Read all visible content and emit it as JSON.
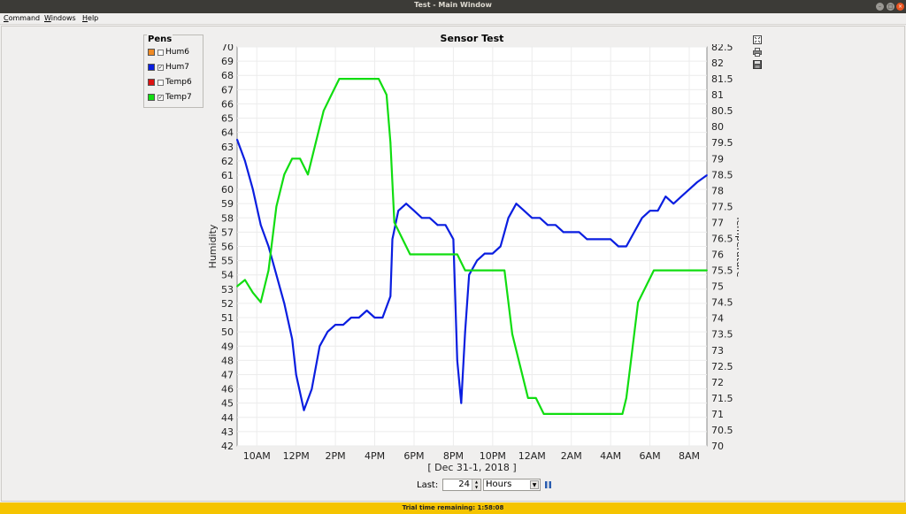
{
  "window": {
    "title": "Test - Main Window",
    "min_glyph": "–",
    "max_glyph": "□",
    "close_glyph": "×"
  },
  "menu": [
    {
      "mnemonic": "C",
      "rest": "ommand"
    },
    {
      "mnemonic": "W",
      "rest": "indows"
    },
    {
      "mnemonic": "H",
      "rest": "elp"
    }
  ],
  "pens": {
    "title": "Pens",
    "items": [
      {
        "label": "Hum6",
        "color": "#f08a24",
        "checked": false,
        "mark": ""
      },
      {
        "label": "Hum7",
        "color": "#0a1ee0",
        "checked": true,
        "mark": "✓"
      },
      {
        "label": "Temp6",
        "color": "#dd1111",
        "checked": false,
        "mark": ""
      },
      {
        "label": "Temp7",
        "color": "#11dd11",
        "checked": true,
        "mark": "✓"
      }
    ]
  },
  "toolbar_icons": [
    "zoom-icon",
    "print-icon",
    "save-icon"
  ],
  "controls": {
    "last_label": "Last:",
    "last_value": "24",
    "unit": "Hours",
    "spin_up": "▲",
    "spin_down": "▼",
    "dropdown_glyph": "▼"
  },
  "status": {
    "text": "Trial time remaining: 1:58:08"
  },
  "chart_data": {
    "type": "line",
    "title": "Sensor Test",
    "xlabel": "[ Dec 31-1, 2018 ]",
    "ylabel": "Humidity",
    "y2label": "Temperature",
    "x_ticks": [
      "10AM",
      "12PM",
      "2PM",
      "4PM",
      "6PM",
      "8PM",
      "10PM",
      "12AM",
      "2AM",
      "4AM",
      "6AM",
      "8AM"
    ],
    "x_range_hours": [
      9.0,
      32.9
    ],
    "ylim": [
      42,
      70
    ],
    "y_ticks": [
      42,
      43,
      44,
      45,
      46,
      47,
      48,
      49,
      50,
      51,
      52,
      53,
      54,
      55,
      56,
      57,
      58,
      59,
      60,
      61,
      62,
      63,
      64,
      65,
      66,
      67,
      68,
      69,
      70
    ],
    "y2lim": [
      70,
      82.5
    ],
    "y2_ticks": [
      "70",
      "70.5",
      "71",
      "71.5",
      "72",
      "72.5",
      "73",
      "73.5",
      "74",
      "74.5",
      "75",
      "75.5",
      "76",
      "76.5",
      "77",
      "77.5",
      "78",
      "78.5",
      "79",
      "79.5",
      "80",
      "80.5",
      "81",
      "81.5",
      "82",
      "82.5"
    ],
    "grid": true,
    "series": [
      {
        "name": "Hum7",
        "axis": "left",
        "color": "#0a1ee0",
        "x": [
          9.0,
          9.4,
          9.8,
          10.2,
          10.6,
          11.0,
          11.4,
          11.8,
          12.0,
          12.4,
          12.8,
          13.2,
          13.6,
          14.0,
          14.4,
          14.8,
          15.2,
          15.6,
          16.0,
          16.4,
          16.8,
          16.9,
          17.2,
          17.6,
          18.0,
          18.4,
          18.8,
          19.2,
          19.6,
          20.0,
          20.2,
          20.4,
          20.6,
          20.8,
          21.2,
          21.6,
          22.0,
          22.4,
          22.6,
          22.8,
          23.2,
          23.6,
          24.0,
          24.4,
          24.8,
          25.2,
          25.6,
          26.0,
          26.4,
          26.8,
          27.2,
          27.6,
          28.0,
          28.4,
          28.8,
          29.2,
          29.6,
          30.0,
          30.4,
          30.8,
          31.2,
          31.6,
          32.0,
          32.4,
          32.9
        ],
        "values": [
          63.5,
          62.0,
          60.0,
          57.5,
          56.0,
          54.0,
          52.0,
          49.5,
          47.0,
          44.5,
          46.0,
          49.0,
          50.0,
          50.5,
          50.5,
          51.0,
          51.0,
          51.5,
          51.0,
          51.0,
          52.5,
          56.5,
          58.5,
          59.0,
          58.5,
          58.0,
          58.0,
          57.5,
          57.5,
          56.5,
          48.0,
          45.0,
          50.0,
          54.0,
          55.0,
          55.5,
          55.5,
          56.0,
          57.0,
          58.0,
          59.0,
          58.5,
          58.0,
          58.0,
          57.5,
          57.5,
          57.0,
          57.0,
          57.0,
          56.5,
          56.5,
          56.5,
          56.5,
          56.0,
          56.0,
          57.0,
          58.0,
          58.5,
          58.5,
          59.5,
          59.0,
          59.5,
          60.0,
          60.5,
          61.0
        ]
      },
      {
        "name": "Temp7",
        "axis": "right",
        "color": "#11dd11",
        "x": [
          9.0,
          9.4,
          9.8,
          10.2,
          10.6,
          11.0,
          11.4,
          11.8,
          12.2,
          12.6,
          13.0,
          13.4,
          13.8,
          14.2,
          14.6,
          15.0,
          15.4,
          15.8,
          16.2,
          16.6,
          16.8,
          17.0,
          17.4,
          17.8,
          18.2,
          18.6,
          19.0,
          19.4,
          19.8,
          20.2,
          20.6,
          21.0,
          21.4,
          21.8,
          22.2,
          22.6,
          22.8,
          23.0,
          23.4,
          23.8,
          24.2,
          24.6,
          25.0,
          25.4,
          25.8,
          26.2,
          26.6,
          27.0,
          27.4,
          27.8,
          28.2,
          28.6,
          28.8,
          29.0,
          29.4,
          29.8,
          30.2,
          30.6,
          31.0,
          31.4,
          31.8,
          32.2,
          32.6,
          32.9
        ],
        "values": [
          75.0,
          75.2,
          74.8,
          74.5,
          75.5,
          77.5,
          78.5,
          79.0,
          79.0,
          78.5,
          79.5,
          80.5,
          81.0,
          81.5,
          81.5,
          81.5,
          81.5,
          81.5,
          81.5,
          81.0,
          79.5,
          77.0,
          76.5,
          76.0,
          76.0,
          76.0,
          76.0,
          76.0,
          76.0,
          76.0,
          75.5,
          75.5,
          75.5,
          75.5,
          75.5,
          75.5,
          74.5,
          73.5,
          72.5,
          71.5,
          71.5,
          71.0,
          71.0,
          71.0,
          71.0,
          71.0,
          71.0,
          71.0,
          71.0,
          71.0,
          71.0,
          71.0,
          71.5,
          72.5,
          74.5,
          75.0,
          75.5,
          75.5,
          75.5,
          75.5,
          75.5,
          75.5,
          75.5,
          75.5
        ]
      }
    ]
  }
}
